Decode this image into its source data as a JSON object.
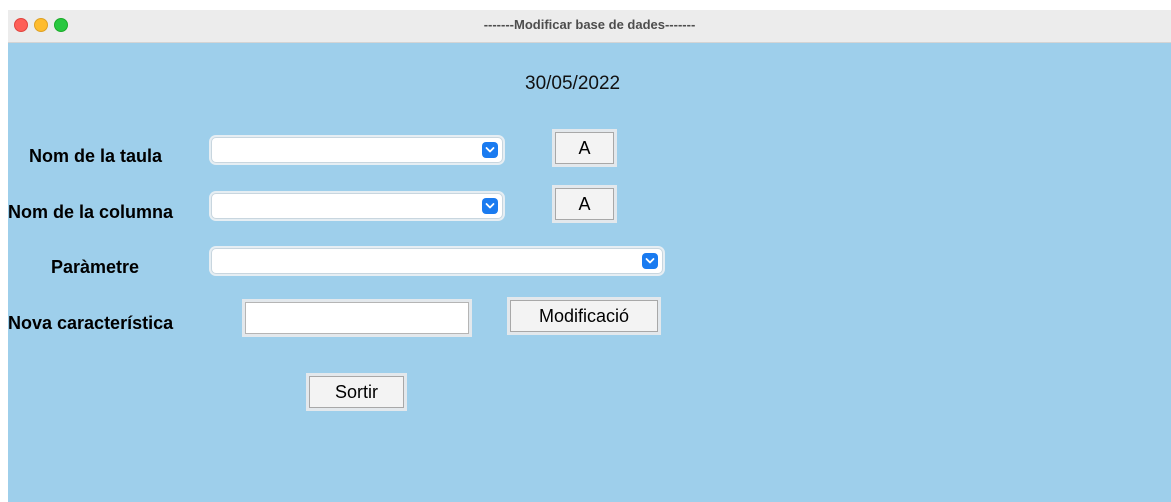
{
  "window": {
    "title": "-------Modificar base de dades-------"
  },
  "date": "30/05/2022",
  "form": {
    "table_label": "Nom de la taula",
    "table_select_value": "",
    "table_button_label": "A",
    "column_label": "Nom de la columna",
    "column_select_value": "",
    "column_button_label": "A",
    "parameter_label": "Paràmetre",
    "parameter_select_value": "",
    "new_feature_label": "Nova característica",
    "new_feature_value": "",
    "modify_button_label": "Modificació",
    "exit_button_label": "Sortir"
  },
  "colors": {
    "background": "#9ecfeb",
    "select_accent": "#1a7bf0"
  },
  "icons": {
    "select_arrow": "chevron-down-icon"
  }
}
